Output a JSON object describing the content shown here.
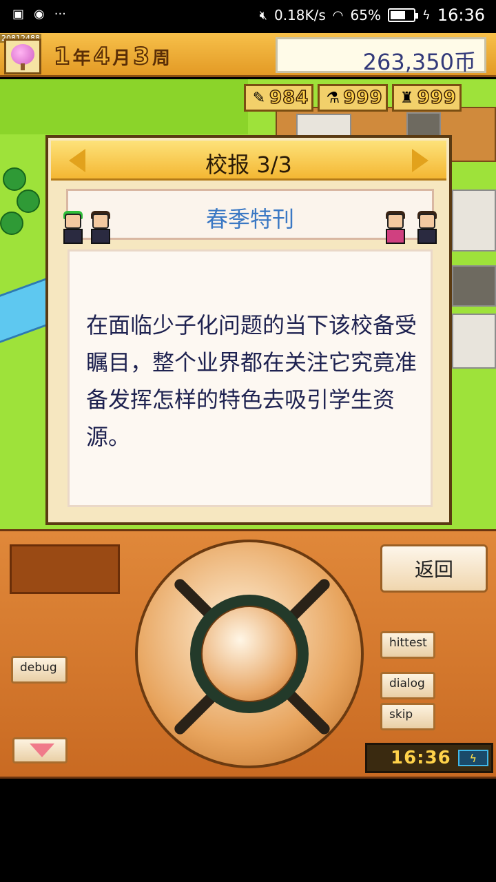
{
  "status_bar": {
    "net_speed": "0.18K/s",
    "battery_percent": "65%",
    "battery_level": 0.65,
    "time": "16:36",
    "icons": [
      "image-icon",
      "chat-icon",
      "more-icon",
      "mute-icon",
      "wifi-icon",
      "battery-icon",
      "charging-icon"
    ]
  },
  "hud": {
    "overlay_id": "20812488",
    "date": {
      "year": "1",
      "year_unit": "年",
      "month": "4",
      "month_unit": "月",
      "week": "3",
      "week_unit": "周"
    },
    "money": "263,350币"
  },
  "resources": [
    {
      "icon": "pencil-icon",
      "glyph": "✎",
      "value": "984"
    },
    {
      "icon": "flask-icon",
      "glyph": "⚗",
      "value": "999"
    },
    {
      "icon": "trophy-icon",
      "glyph": "♜",
      "value": "999"
    }
  ],
  "dialog": {
    "title": "校报 3/3",
    "headline": "春季特刊",
    "article": "在面临少子化问题的当下该校备受瞩目，整个业界都在关注它究竟准备发挥怎样的特色去吸引学生资源。"
  },
  "controls": {
    "return_label": "返回",
    "debug_label": "debug",
    "hittest_label": "hittest",
    "dialog_label": "dialog",
    "skip_label": "skip",
    "clock_time": "16:36"
  },
  "colors": {
    "hud_orange": "#f7c04a",
    "headline_blue": "#3a78c4",
    "article_text": "#1e2250",
    "grass": "#9ee23a"
  }
}
